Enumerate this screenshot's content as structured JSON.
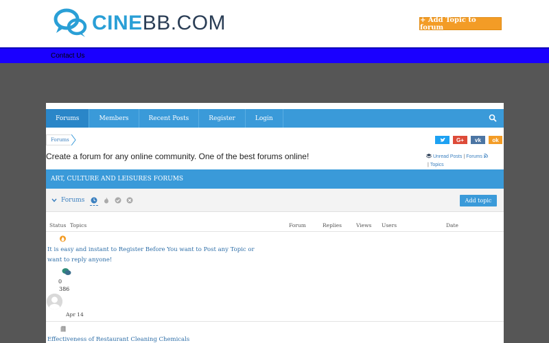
{
  "header": {
    "logo_part1": "CINE",
    "logo_part2": "BB.COM",
    "add_topic_label": "+ Add Topic to forum"
  },
  "top_nav": {
    "contact_label": "Contact Us"
  },
  "menu": {
    "items": [
      {
        "label": "Forums"
      },
      {
        "label": "Members"
      },
      {
        "label": "Recent Posts"
      },
      {
        "label": "Register"
      },
      {
        "label": "Login"
      }
    ]
  },
  "breadcrumb": {
    "label": "Forums"
  },
  "social": [
    {
      "name": "twitter-icon",
      "glyph": "t",
      "color": "#1da1f2"
    },
    {
      "name": "google-plus-icon",
      "glyph": "G+",
      "color": "#dd4b39"
    },
    {
      "name": "vk-icon",
      "glyph": "vk",
      "color": "#4c75a3"
    },
    {
      "name": "odnoklassniki-icon",
      "glyph": "ok",
      "color": "#f39c26"
    }
  ],
  "site_description": "Create a forum for any online community. One of the best forums online!",
  "quicklinks": {
    "unread": "Unread Posts",
    "forums": "Forums",
    "topics": "Topics",
    "sep": "|"
  },
  "category": {
    "title": "ART, CULTURE AND LEISURES FORUMS"
  },
  "forums_bar": {
    "toggle_label": "Forums",
    "add_topic_label": "Add topic"
  },
  "columns": {
    "status": "Status",
    "topics": "Topics",
    "forum": "Forum",
    "replies": "Replies",
    "views": "Views",
    "users": "Users",
    "date": "Date"
  },
  "topics": [
    {
      "title_line1": "It is easy and instant to Register Before You want to Post any Topic or",
      "title_line2": "want to reply anyone!",
      "replies": "0",
      "views": "386",
      "date": "Apr 14"
    },
    {
      "title_line1": "Effectiveness of Restaurant Cleaning Chemicals"
    }
  ],
  "colors": {
    "brand_blue": "#2a9fd6",
    "nav_blue": "#3a9ad9",
    "accent_orange": "#f39c26",
    "strip_blue": "#1a00ff"
  }
}
